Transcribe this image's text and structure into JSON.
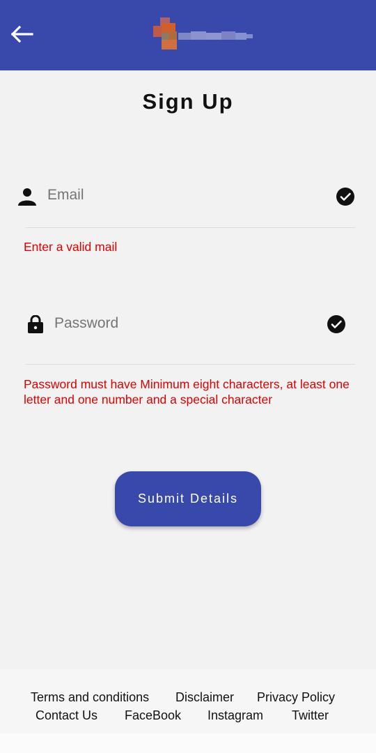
{
  "header": {
    "back_icon": "arrow-left-icon",
    "colors": {
      "app_bar": "#3949ab"
    }
  },
  "page": {
    "title": "Sign Up"
  },
  "form": {
    "email": {
      "icon": "person-icon",
      "placeholder": "Email",
      "status_icon": "check-circle-icon",
      "error": "Enter a valid mail"
    },
    "password": {
      "icon": "lock-icon",
      "placeholder": "Password",
      "status_icon": "check-circle-icon",
      "error": "Password must have Minimum eight characters, at least one letter and one number and a special character"
    },
    "submit_label": "Submit Details",
    "colors": {
      "error": "#e00000",
      "button": "#3949ab"
    }
  },
  "footer": {
    "links": [
      "Terms and conditions",
      "Disclaimer",
      "Privacy Policy",
      "Contact Us",
      "FaceBook",
      "Instagram",
      "Twitter"
    ]
  }
}
